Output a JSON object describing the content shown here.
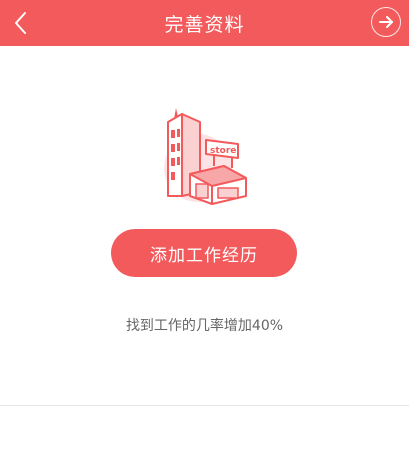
{
  "header": {
    "title": "完善资料",
    "back_icon": "chevron-left-icon",
    "next_icon": "arrow-right-circle-icon"
  },
  "main": {
    "illustration_icon": "store-building-icon",
    "illustration_label": "store",
    "add_button_label": "添加工作经历",
    "hint_text": "找到工作的几率增加40%"
  },
  "colors": {
    "brand": "#f25a5c",
    "text_muted": "#666666",
    "divider": "#e6e6e6"
  }
}
